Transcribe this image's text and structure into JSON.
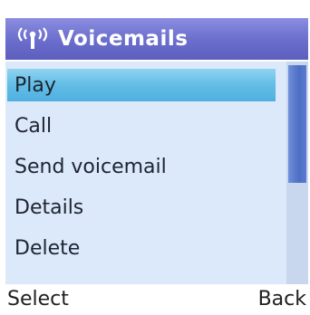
{
  "header": {
    "title": "Voicemails",
    "icon": "antenna-signal-icon"
  },
  "menu": {
    "items": [
      {
        "label": "Play",
        "selected": true
      },
      {
        "label": "Call",
        "selected": false
      },
      {
        "label": "Send voicemail",
        "selected": false
      },
      {
        "label": "Details",
        "selected": false
      },
      {
        "label": "Delete",
        "selected": false
      }
    ]
  },
  "softkeys": {
    "left": "Select",
    "right": "Back"
  },
  "colors": {
    "titlebar": "#6a6dcb",
    "menu_background": "#dbe9fb",
    "selection": "#62bde6",
    "scroll_thumb": "#4d6ec4"
  }
}
